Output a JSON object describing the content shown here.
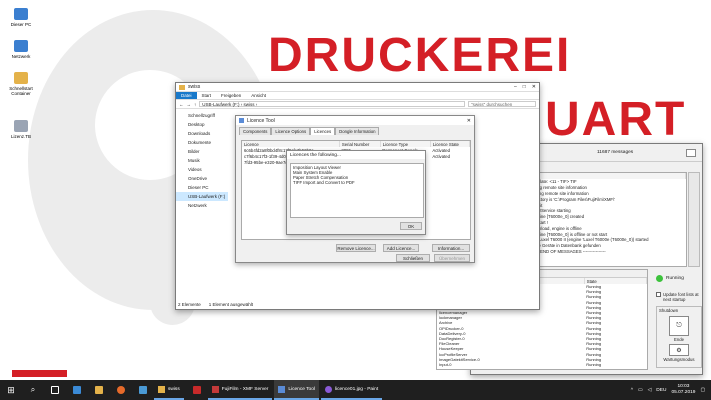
{
  "wallpaper": {
    "brand_line1": "DRUCKEREI",
    "brand_line2": "UART",
    "colors": {
      "brand_red": "#d41f26",
      "logo_grey": "#ececec"
    }
  },
  "desktop_icons": [
    {
      "label": "Dieser PC",
      "icon": "pc-icon",
      "color": "#3b7fd0"
    },
    {
      "label": "Netzwerk",
      "icon": "network-icon",
      "color": "#3b7fd0"
    },
    {
      "label": "Schnellstart Container",
      "icon": "folder-shortcut-icon",
      "color": "#e4b24a"
    },
    {
      "label": "Lizenz.TB",
      "icon": "document-icon",
      "color": "#9aa4b4"
    }
  ],
  "explorer": {
    "title": "swiss",
    "ribbon_tabs": [
      "Datei",
      "Start",
      "Freigeben",
      "Ansicht"
    ],
    "path": "USB-Laufwerk (F:)  ›  swiss  ›",
    "search_placeholder": "\"swiss\" durchsuchen",
    "nav_items": [
      "Schnellzugriff",
      "Desktop",
      "Downloads",
      "Dokumente",
      "Bilder",
      "Musik",
      "Videos",
      "OneDrive",
      "Dieser PC",
      "USB-Laufwerk (F:)",
      "Netzwerk"
    ],
    "status_count": "2 Elemente",
    "status_selected": "1 Element ausgewählt"
  },
  "licence_tool": {
    "title": "Licence Tool",
    "tabs": [
      "Components",
      "Licence Options",
      "Licences",
      "Dongle Information"
    ],
    "columns": [
      "Licence",
      "Serial Number",
      "Licence Type",
      "Licence State"
    ],
    "rows": [
      [
        "6c6b4fd2a8f0bd4f8c17f9cfe3b50b8a...",
        "3086",
        "Permanent Dongle",
        "Activated"
      ],
      [
        "c7f6b4c17f3-1f39-4d02 f5ee...",
        "",
        "",
        "Activated"
      ],
      [
        "7fd3-95be-e320-9ae7d...",
        "",
        "",
        ""
      ]
    ],
    "buttons": {
      "remove": "Remove Licence...",
      "add": "Add Licence...",
      "information": "Information...",
      "close": "Schließen",
      "apply": "Übernehmen"
    }
  },
  "licence_popup": {
    "title": "Licences the following...",
    "items": [
      "Imposition Layout Viewer",
      "Main System Enable",
      "Paper Stretch Compensation",
      "TIFF Import and Convert to PDF"
    ],
    "ok": "OK"
  },
  "service_window": {
    "messages_count": "11687 messages",
    "log_columns": [
      "ID",
      "Message"
    ],
    "log_rows": [
      [
        "01",
        "1097-0002",
        "Adding template: <11 - TIF> TIF"
      ],
      [
        "01",
        "5067-0005",
        "start updating remote site information"
      ],
      [
        "01",
        "5067-0006",
        "finish updating remote site information"
      ],
      [
        "02",
        "6885-0007",
        "System directory is 'C:\\Program Files\\FujiFilm\\XMF\\'"
      ],
      [
        "02",
        "6885-0002",
        "System bereit"
      ],
      [
        "02",
        "5679-0001",
        "TIFFImporterService starting"
      ],
      [
        "02",
        "7952-0001",
        "PdfSpecEngine [T6000e_0] created"
      ],
      [
        "02",
        "7629-0001",
        "T6000e_0 Start !"
      ],
      [
        "04",
        "7952-0007",
        "Cannot download, engine is offline"
      ],
      [
        "05",
        "7952-0017",
        "PdfSpecEngine [T6000e_0] is offline or not start"
      ],
      [
        "05",
        "4006-0054",
        "Interface to Luxel T6000 II (engine 'Luxel T6000e (T6000e_0)) started"
      ],
      [
        "05",
        "4006-0076",
        "1 zusätzliche Geräte in Datenbank gefunden"
      ],
      [
        "",
        "",
        "---------------- END OF MESSAGES ----------------"
      ]
    ],
    "system_status_title": "System Status",
    "status_columns": [
      "Process",
      "State"
    ],
    "status_rows": [
      [
        "dbvmdb",
        "Running"
      ],
      [
        "lpcdaemon",
        "Running"
      ],
      [
        "logger",
        "Running"
      ],
      [
        "jobmg",
        "Running"
      ],
      [
        "jobmanager",
        "Running"
      ],
      [
        "licencemanager",
        "Running"
      ],
      [
        "lockmanager",
        "Running"
      ],
      [
        "Archive",
        "Running"
      ],
      [
        "OPIDrucker-0",
        "Running"
      ],
      [
        "DataDelivery-0",
        "Running"
      ],
      [
        "DocRegister-0",
        "Running"
      ],
      [
        "FileCleaner",
        "Running"
      ],
      [
        "HouseKeeper",
        "Running"
      ],
      [
        "IccProfileServer",
        "Running"
      ],
      [
        "ImageGatekitService-0",
        "Running"
      ],
      [
        "Input-0",
        "Running"
      ]
    ],
    "running_label": "Running",
    "update_label": "Update font lists at next startup",
    "shutdown_label": "Shutdown",
    "shutdown_buttons": [
      "Ende",
      "Wartungsmodus"
    ],
    "status_color": "#3cc23c"
  },
  "taskbar": {
    "apps": [
      {
        "label": "swiss",
        "icon": "folder-icon",
        "color": "#e4b24a"
      },
      {
        "label": "FujiFilm - XMF Server",
        "icon": "app-icon",
        "color": "#c43a3a"
      },
      {
        "label": "Licence Tool",
        "icon": "key-icon",
        "color": "#5a8bd6"
      },
      {
        "label": "licence01.jpg - Paint",
        "icon": "paint-icon",
        "color": "#8a5ad6"
      }
    ],
    "lang": "DEU",
    "time": "10:03",
    "date": "05.07.2019"
  }
}
